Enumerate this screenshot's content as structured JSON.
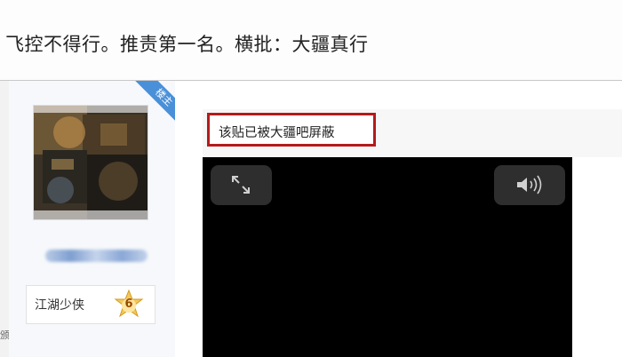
{
  "header": {
    "title": "飞控不得行。推责第一名。横批：大疆真行"
  },
  "left_edge": {
    "fragment": "颁"
  },
  "user": {
    "badge_label": "楼主",
    "level_name": "江湖少侠",
    "level_number": "6",
    "badge_color": "#4a90d9"
  },
  "post": {
    "blocked_notice": "该贴已被大疆吧屏蔽",
    "notice_border_color": "#b41b1b"
  },
  "video": {
    "fullscreen_icon": "expand-icon",
    "volume_icon": "volume-icon"
  }
}
